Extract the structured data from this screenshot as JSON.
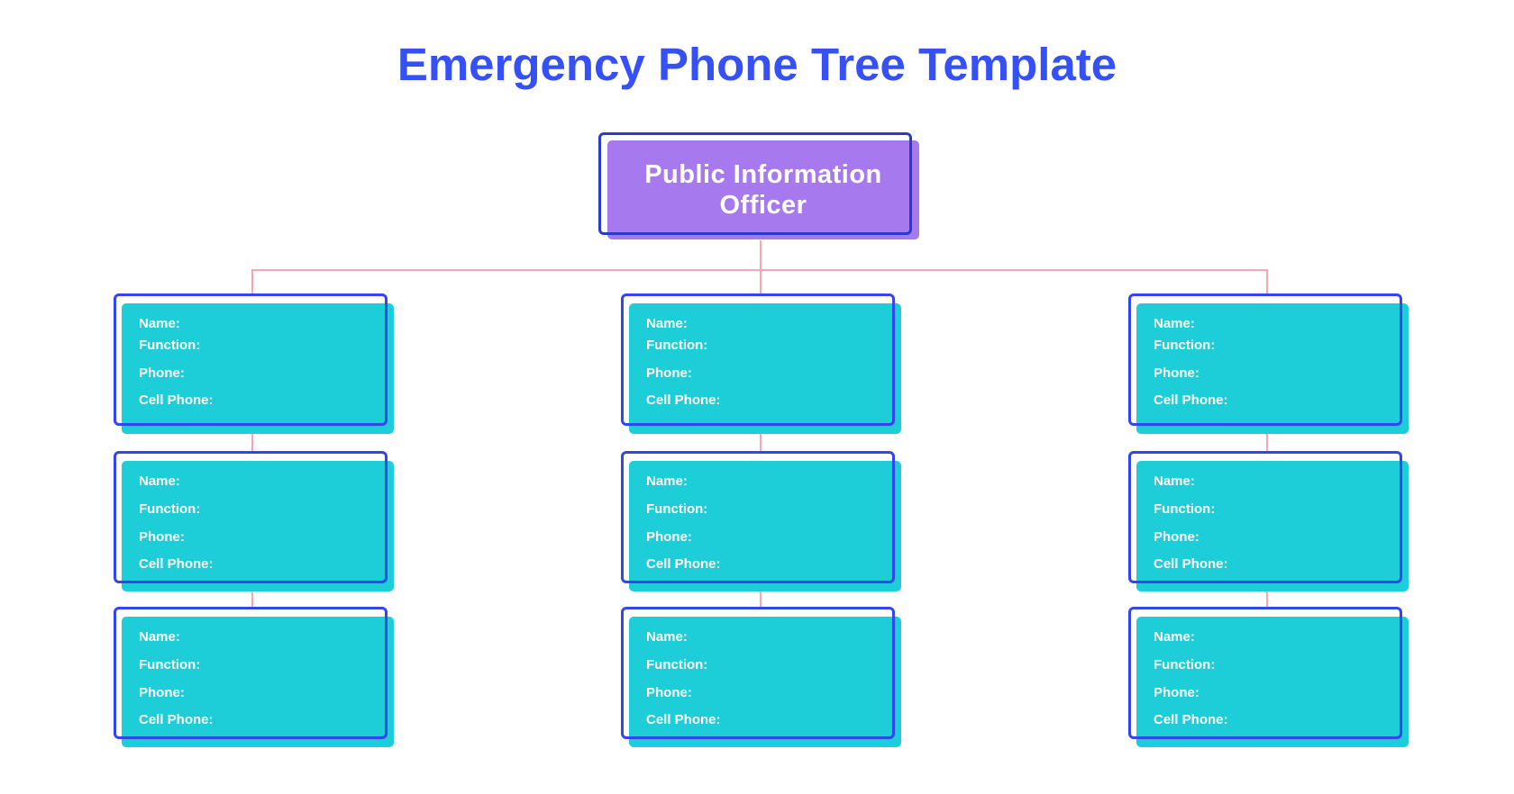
{
  "title": "Emergency Phone Tree Template",
  "root": {
    "label_line1": "Public Information",
    "label_line2": "Officer"
  },
  "field_labels": {
    "name": "Name:",
    "function": "Function:",
    "phone": "Phone:",
    "cell": "Cell Phone:"
  },
  "colors": {
    "title": "#3550f5",
    "root_fill": "#a779ef",
    "card_fill": "#1dcdd8",
    "outline": "#3346ee",
    "connector": "#f7a6b8"
  },
  "columns": [
    {
      "cards": [
        {
          "name": "",
          "function": "",
          "phone": "",
          "cell_phone": ""
        },
        {
          "name": "",
          "function": "",
          "phone": "",
          "cell_phone": ""
        },
        {
          "name": "",
          "function": "",
          "phone": "",
          "cell_phone": ""
        }
      ]
    },
    {
      "cards": [
        {
          "name": "",
          "function": "",
          "phone": "",
          "cell_phone": ""
        },
        {
          "name": "",
          "function": "",
          "phone": "",
          "cell_phone": ""
        },
        {
          "name": "",
          "function": "",
          "phone": "",
          "cell_phone": ""
        }
      ]
    },
    {
      "cards": [
        {
          "name": "",
          "function": "",
          "phone": "",
          "cell_phone": ""
        },
        {
          "name": "",
          "function": "",
          "phone": "",
          "cell_phone": ""
        },
        {
          "name": "",
          "function": "",
          "phone": "",
          "cell_phone": ""
        }
      ]
    }
  ]
}
